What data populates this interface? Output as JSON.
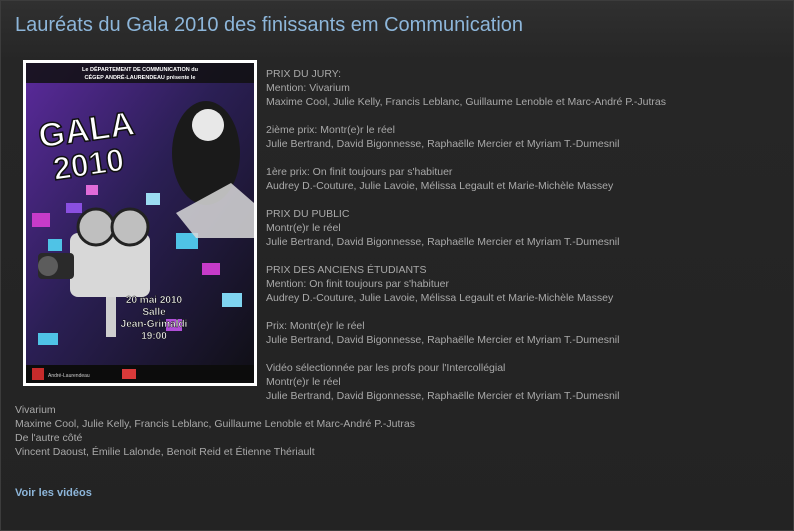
{
  "page": {
    "title": "Lauréats du Gala 2010 des finissants em Communication"
  },
  "poster": {
    "header_line1": "Le DÉPARTEMENT DE COMMUNICATION du",
    "header_line2": "CÉGEP ANDRÉ-LAURENDEAU présente le",
    "gala_word": "GALA",
    "year": "2010",
    "date_line1": "20 mai 2010",
    "date_line2": "Salle",
    "date_line3": "Jean-Grimaldi",
    "date_line4": "19:00",
    "logo_left": "André-Laurendeau",
    "colors": {
      "purple": "#6a2fa8",
      "magenta": "#c63bc9",
      "cyan": "#4fc3e6",
      "dark": "#161616"
    }
  },
  "awards": {
    "jury": {
      "heading": "PRIX DU JURY:",
      "mention": "Mention:   Vivarium",
      "mention_names": "Maxime Cool, Julie Kelly, Francis Leblanc, Guillaume Lenoble et Marc-André P.-Jutras"
    },
    "second": {
      "prize": "2ième prix:  Montr(e)r le réel",
      "names": "Julie Bertrand, David Bigonnesse, Raphaëlle Mercier et Myriam T.-Dumesnil"
    },
    "first": {
      "prize": "1ère prix: On finit toujours par s'habituer",
      "names": "Audrey D.-Couture, Julie Lavoie, Mélissa Legault et Marie-Michèle Massey"
    },
    "public": {
      "heading": "PRIX DU PUBLIC",
      "film": "Montr(e)r le réel",
      "names": "Julie Bertrand, David Bigonnesse, Raphaëlle Mercier et Myriam T.-Dumesnil"
    },
    "alumni": {
      "heading": "PRIX DES ANCIENS ÉTUDIANTS",
      "mention": "Mention: On finit toujours par s'habituer",
      "mention_names": "Audrey D.-Couture, Julie Lavoie, Mélissa Legault et Marie-Michèle Massey",
      "prize": "Prix: Montr(e)r le réel",
      "prize_names": "Julie Bertrand, David Bigonnesse, Raphaëlle Mercier et Myriam T.-Dumesnil"
    },
    "intercollegial": {
      "heading": "Vidéo sélectionnée par les profs pour l'Intercollégial",
      "film1": "Montr(e)r le réel",
      "film1_names": "Julie Bertrand, David Bigonnesse, Raphaëlle Mercier et Myriam T.-Dumesnil",
      "film2": "Vivarium",
      "film2_names": "Maxime Cool, Julie Kelly, Francis Leblanc, Guillaume Lenoble et Marc-André P.-Jutras",
      "film3": "De l'autre côté",
      "film3_names": "Vincent Daoust,  Émilie Lalonde, Benoit Reid et Étienne Thériault"
    }
  },
  "footer": {
    "videos_link": "Voir les vidéos"
  }
}
